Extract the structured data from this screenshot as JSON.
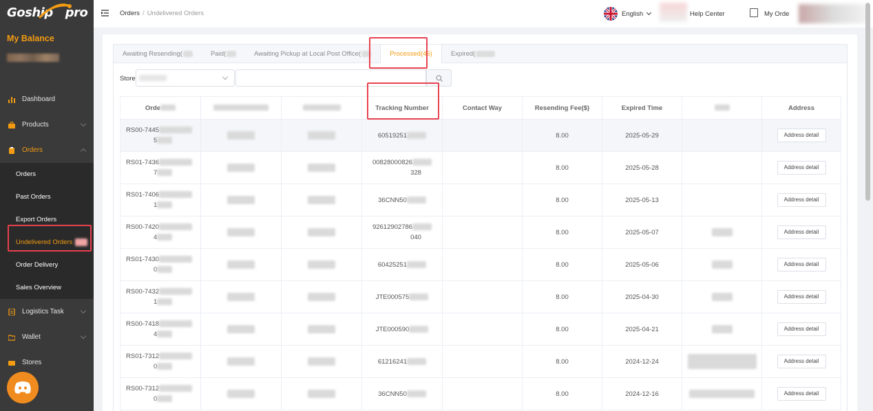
{
  "sidebar": {
    "logo": "Goship",
    "logo_suffix": "pro",
    "balance_title": "My Balance",
    "items": [
      {
        "label": "Dashboard",
        "icon": "chart-bar-icon"
      },
      {
        "label": "Products",
        "icon": "bag-icon"
      },
      {
        "label": "Orders",
        "icon": "clipboard-icon"
      },
      {
        "label": "Logistics Task",
        "icon": "document-icon"
      },
      {
        "label": "Wallet",
        "icon": "folder-icon"
      },
      {
        "label": "Stores",
        "icon": "store-icon"
      }
    ],
    "orders_sub": [
      "Orders",
      "Past Orders",
      "Export Orders",
      "Undelivered Orders",
      "Order Delivery",
      "Sales Overview"
    ],
    "accent": "#f39c12"
  },
  "header": {
    "breadcrumb_root": "Orders",
    "breadcrumb_sep": "/",
    "breadcrumb_current": "Undelivered Orders",
    "language": "English",
    "help": "Help Center",
    "my_order": "My Orde"
  },
  "tabs": [
    {
      "label": "Awaiting Resending("
    },
    {
      "label": "Paid("
    },
    {
      "label": "Awaiting Pickup at Local Post Office("
    },
    {
      "label": "Processed(45)"
    },
    {
      "label": "Expired("
    }
  ],
  "filter": {
    "store_label": "Store",
    "search_placeholder": ""
  },
  "table": {
    "headers": [
      "Orde",
      "",
      "",
      "Tracking Number",
      "Contact Way",
      "Resending Fee($)",
      "Expired Time",
      "",
      "Address"
    ],
    "address_button": "Address detail",
    "rows": [
      {
        "order_a": "RS00-7445",
        "order_b": "5",
        "tracking_a": "60519251",
        "tracking_b": "",
        "fee": "8.00",
        "expired": "2025-05-29"
      },
      {
        "order_a": "RS01-7436",
        "order_b": "7",
        "tracking_a": "00828000826",
        "tracking_b": "328",
        "fee": "8.00",
        "expired": "2025-05-28"
      },
      {
        "order_a": "RS01-7406",
        "order_b": "1",
        "tracking_a": "36CNN50",
        "tracking_b": "",
        "fee": "8.00",
        "expired": "2025-05-13"
      },
      {
        "order_a": "RS00-7420",
        "order_b": "4",
        "tracking_a": "92612902786",
        "tracking_b": "040",
        "fee": "8.00",
        "expired": "2025-05-07"
      },
      {
        "order_a": "RS01-7430",
        "order_b": "0",
        "tracking_a": "60425251",
        "tracking_b": "",
        "fee": "8.00",
        "expired": "2025-05-06"
      },
      {
        "order_a": "RS00-7432",
        "order_b": "1",
        "tracking_a": "JTE000575",
        "tracking_b": "",
        "fee": "8.00",
        "expired": "2025-04-30"
      },
      {
        "order_a": "RS00-7418",
        "order_b": "4",
        "tracking_a": "JTE000590",
        "tracking_b": "",
        "fee": "8.00",
        "expired": "2025-04-21"
      },
      {
        "order_a": "RS01-7312",
        "order_b": "0",
        "tracking_a": "61216241",
        "tracking_b": "",
        "fee": "8.00",
        "expired": "2024-12-24"
      },
      {
        "order_a": "RS00-7312",
        "order_b": "0",
        "tracking_a": "36CNN50",
        "tracking_b": "",
        "fee": "8.00",
        "expired": "2024-12-16"
      }
    ]
  }
}
